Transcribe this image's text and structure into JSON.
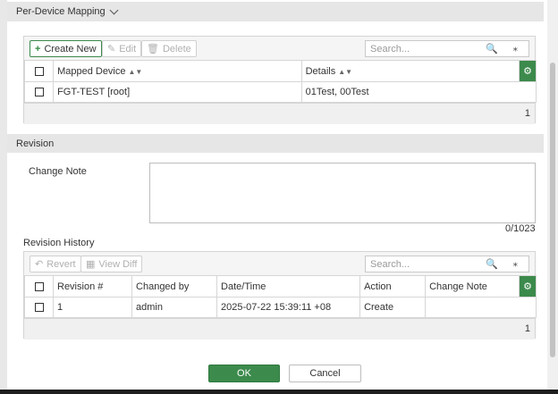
{
  "per_device_mapping": {
    "section_title": "Per-Device Mapping",
    "toolbar": {
      "create_new": "Create New",
      "edit": "Edit",
      "delete": "Delete",
      "search_placeholder": "Search..."
    },
    "columns": [
      "Mapped Device",
      "Details"
    ],
    "rows": [
      {
        "mapped_device": "FGT-TEST [root]",
        "details": "01Test, 00Test"
      }
    ],
    "count": "1"
  },
  "revision": {
    "section_title": "Revision",
    "change_note_label": "Change Note",
    "change_note_value": "",
    "char_counter": "0/1023",
    "history_label": "Revision History",
    "toolbar": {
      "revert": "Revert",
      "view_diff": "View Diff",
      "search_placeholder": "Search..."
    },
    "columns": [
      "Revision #",
      "Changed by",
      "Date/Time",
      "Action",
      "Change Note"
    ],
    "rows": [
      {
        "revision": "1",
        "changed_by": "admin",
        "datetime": "2025-07-22 15:39:11 +08",
        "action": "Create",
        "change_note": ""
      }
    ],
    "count": "1"
  },
  "buttons": {
    "ok": "OK",
    "cancel": "Cancel"
  },
  "icons": {
    "plus": "plus-icon",
    "edit": "edit-icon",
    "delete": "trash-icon",
    "search": "magnifier-icon",
    "regex": "asterisk-icon",
    "settings": "gear-icon",
    "revert": "undo-icon",
    "diff": "diff-icon",
    "expand": "chevron-down-icon"
  },
  "colors": {
    "accent": "#3c8a4c",
    "header_bg": "#e6e6e6"
  }
}
